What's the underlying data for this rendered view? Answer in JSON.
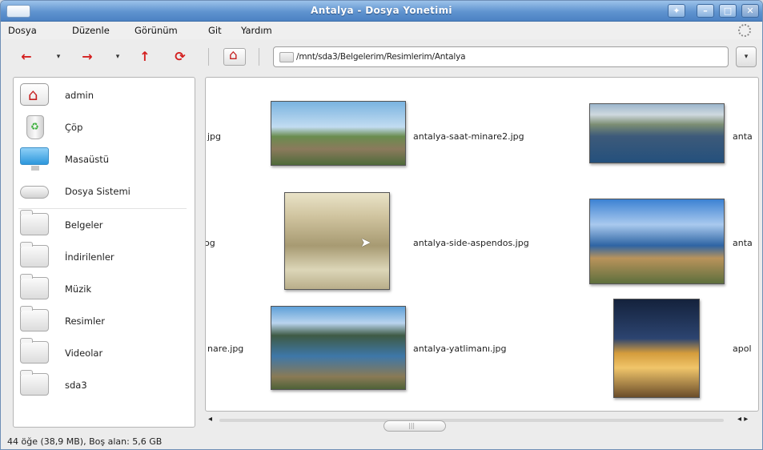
{
  "window": {
    "title": "Antalya - Dosya Yonetimi"
  },
  "titlebar_buttons": {
    "pin": "✦",
    "minimize": "–",
    "maximize": "□",
    "close": "✕"
  },
  "menu": [
    {
      "label": "Dosya"
    },
    {
      "label": "Düzenle"
    },
    {
      "label": "Görünüm"
    },
    {
      "label": "Git"
    },
    {
      "label": "Yardım"
    }
  ],
  "toolbar": {
    "back_icon": "←",
    "forward_icon": "→",
    "up_icon": "↑",
    "reload_icon": "⟳",
    "dropdown_icon": "▾",
    "home_icon": "⌂",
    "path": "/mnt/sda3/Belgelerim/Resimlerim/Antalya"
  },
  "places": [
    {
      "label": "admin",
      "icon": "home-icon"
    },
    {
      "label": "Çöp",
      "icon": "trash-icon"
    },
    {
      "label": "Masaüstü",
      "icon": "desktop-icon"
    },
    {
      "label": "Dosya Sistemi",
      "icon": "drive-icon"
    },
    {
      "label": "Belgeler",
      "icon": "folder-icon"
    },
    {
      "label": "İndirilenler",
      "icon": "folder-icon"
    },
    {
      "label": "Müzik",
      "icon": "folder-icon"
    },
    {
      "label": "Resimler",
      "icon": "folder-icon"
    },
    {
      "label": "Videolar",
      "icon": "folder-icon"
    },
    {
      "label": "sda3",
      "icon": "folder-icon"
    }
  ],
  "files": {
    "row1_left_partial": "jpg",
    "row1_main": "antalya-saat-minare2.jpg",
    "row1_right_partial": "anta",
    "row2_left_partial": "og",
    "row2_main": "antalya-side-aspendos.jpg",
    "row2_right_partial": "anta",
    "row3_left_partial": "nare.jpg",
    "row3_main": "antalya-yatlimanı.jpg",
    "row3_right_partial": "apol"
  },
  "scroll": {
    "left_icon": "◂",
    "right_icon": "◂ ▸",
    "grip": "|||"
  },
  "status": {
    "text": "44 öğe (38,9 MB), Boş alan: 5,6 GB"
  }
}
